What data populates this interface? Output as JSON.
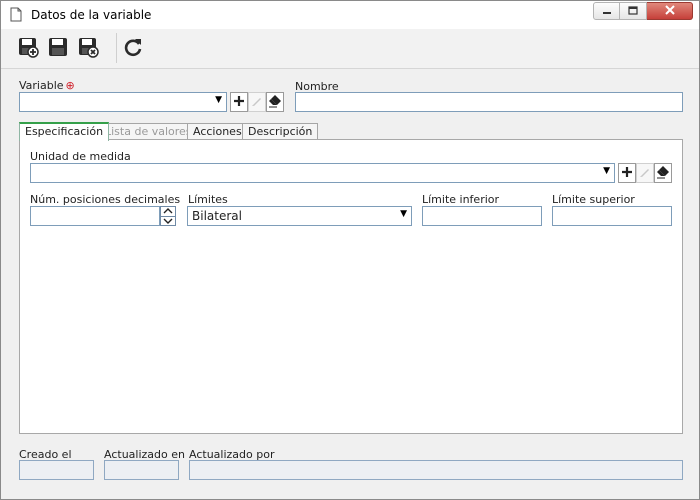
{
  "window": {
    "title": "Datos de la variable",
    "controls": [
      "minimize-icon",
      "maximize-icon",
      "close-icon"
    ]
  },
  "toolbar": {
    "buttons": [
      {
        "name": "save-new-button",
        "icon": "save-new-icon"
      },
      {
        "name": "save-button",
        "icon": "save-icon"
      },
      {
        "name": "save-close-button",
        "icon": "save-close-icon"
      },
      {
        "name": "refresh-button",
        "icon": "refresh-icon"
      }
    ]
  },
  "header": {
    "variable_label": "Variable",
    "variable_value": "",
    "name_label": "Nombre",
    "name_value": ""
  },
  "tabs": [
    {
      "label": "Especificación",
      "active": true
    },
    {
      "label": "Lista de valores",
      "disabled": true
    },
    {
      "label": "Acciones"
    },
    {
      "label": "Descripción"
    }
  ],
  "spec": {
    "unit_label": "Unidad de medida",
    "unit_value": "",
    "decimals_label": "Núm. posiciones decimales",
    "decimals_value": "",
    "limits_label": "Límites",
    "limits_value": "Bilateral",
    "lower_label": "Límite inferior",
    "lower_value": "",
    "upper_label": "Límite superior",
    "upper_value": ""
  },
  "footer": {
    "created_label": "Creado el",
    "created_value": "",
    "updated_label": "Actualizado en",
    "updated_value": "",
    "updated_by_label": "Actualizado por",
    "updated_by_value": ""
  },
  "colors": {
    "accent": "#35a04a",
    "required": "#d0202a",
    "close_button": "#c6403a",
    "input_border": "#7e9db9"
  }
}
